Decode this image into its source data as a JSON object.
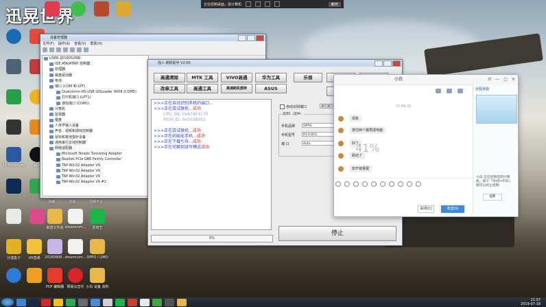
{
  "desktop": {
    "logo_text": "迅晃世界",
    "icons_col1": [
      "",
      "",
      "",
      "",
      "",
      "",
      "",
      "",
      ""
    ],
    "icons_bottom": [
      {
        "label": "S4 Slideshow"
      },
      {
        "label": "Word"
      },
      {
        "label": "腾讯"
      },
      {
        "label": "PS"
      }
    ],
    "bottom_row1": [
      "新建文件夹",
      "steamcom...",
      "爱奇艺"
    ],
    "bottom_row2": [
      "沙漠盒子",
      "VR直通",
      "20180908...",
      "steamcom...",
      "OPPO / LIMO"
    ],
    "bottom_row3": [
      "",
      "",
      "PDF 编辑器",
      "网易云音乐",
      "小白 设备 资料"
    ],
    "mid_labels": [
      "加速",
      "加速",
      "前期平台"
    ]
  },
  "remote_bar": {
    "text": "正在控制桌面，进计算机",
    "close": "断开"
  },
  "device_manager": {
    "title": "设备管理器",
    "menu": [
      "文件(F)",
      "操作(A)",
      "查看(V)",
      "帮助(H)"
    ],
    "tree": [
      "USER-20160526BI",
      "IDE ATA/ATAPI 控制器",
      "处理器",
      "磁盘驱动器",
      "电池",
      "端口 (COM 和 LPT)",
      "Qualcomm HS-USB QDLoader 9008 (COM5)",
      "打印机端口 (LPT1)",
      "通信端口 (COM1)",
      "计算机",
      "监视器",
      "键盘",
      "人体学输入设备",
      "声音、视频和游戏控制器",
      "鼠标和其他指针设备",
      "通用串行总线控制器",
      "网络适配器",
      "Microsoft Teredo Tunneling Adapter",
      "Realtek PCIe GBE Family Controller",
      "TAP-Win32 Adapter V9",
      "TAP-Win32 Adapter V9",
      "TAP-Win32 Adapter V9",
      "TAP-Win32 Adapter V9 #2"
    ]
  },
  "flash_tool": {
    "title": "强人 刷机助手 V2.00",
    "buttons_row1": [
      "高通清除",
      "MTK 工具",
      "VIVO高通",
      "华为工具",
      "乐视"
    ],
    "buttons_row2": [
      "改串工具",
      "高通工具",
      "高通刷机救砖",
      "ASUS"
    ],
    "checkbox_label": "自动识别端口",
    "port_value": "通信端口",
    "fieldset_legend": "选项1（选中）",
    "fields": [
      {
        "label": "手机品牌",
        "value": "OPPO"
      },
      {
        "label": "手机型号",
        "value": "R11(Qt1)"
      },
      {
        "label": "端  口",
        "value": "Auto"
      }
    ],
    "log": [
      {
        "type": "p",
        "prefix": ">>>",
        "text": "正在自动识别手机的端口..."
      },
      {
        "type": "p",
        "prefix": ">>>",
        "text": "正在尝试联机...",
        "ok": "成功"
      },
      {
        "type": "dim",
        "text": "CPU_SN: 0xA74F4170"
      },
      {
        "type": "dim",
        "text": "MSM_ID: 0x000B0E1"
      },
      {
        "type": "blank",
        "text": ""
      },
      {
        "type": "p",
        "prefix": ">>>",
        "text": "正在尝试联机...",
        "ok": "成功"
      },
      {
        "type": "p",
        "prefix": ">>>",
        "text": "正在初始化手机...",
        "ok": "成功"
      },
      {
        "type": "p",
        "prefix": ">>>",
        "text": "正在下载引导...",
        "ok": "成功"
      },
      {
        "type": "p",
        "prefix": ">>>",
        "text": "正在切换到读写模式",
        "ok": "成功"
      }
    ],
    "progress_label": "0%",
    "progress": 0,
    "stop_label": "停止"
  },
  "chat": {
    "title": "小白",
    "timestamp": "21:49:20",
    "messages": [
      {
        "text": "现象"
      },
      {
        "text": "按住两个键再插电脑"
      },
      {
        "text": "好了"
      },
      {
        "text": "刷动了"
      },
      {
        "text": "如开装量键"
      }
    ],
    "overlay_percent": "41%",
    "close_label": "关闭(C)",
    "send_label": "发送(S)",
    "side_title": "远程桌面",
    "side_text": "小白 正在控制您的计算机。按下「Shift+ESC」键可以终止控制",
    "hangup_label": "挂断"
  },
  "taskbar": {
    "time": "21:57",
    "date": "2019-07-18"
  }
}
